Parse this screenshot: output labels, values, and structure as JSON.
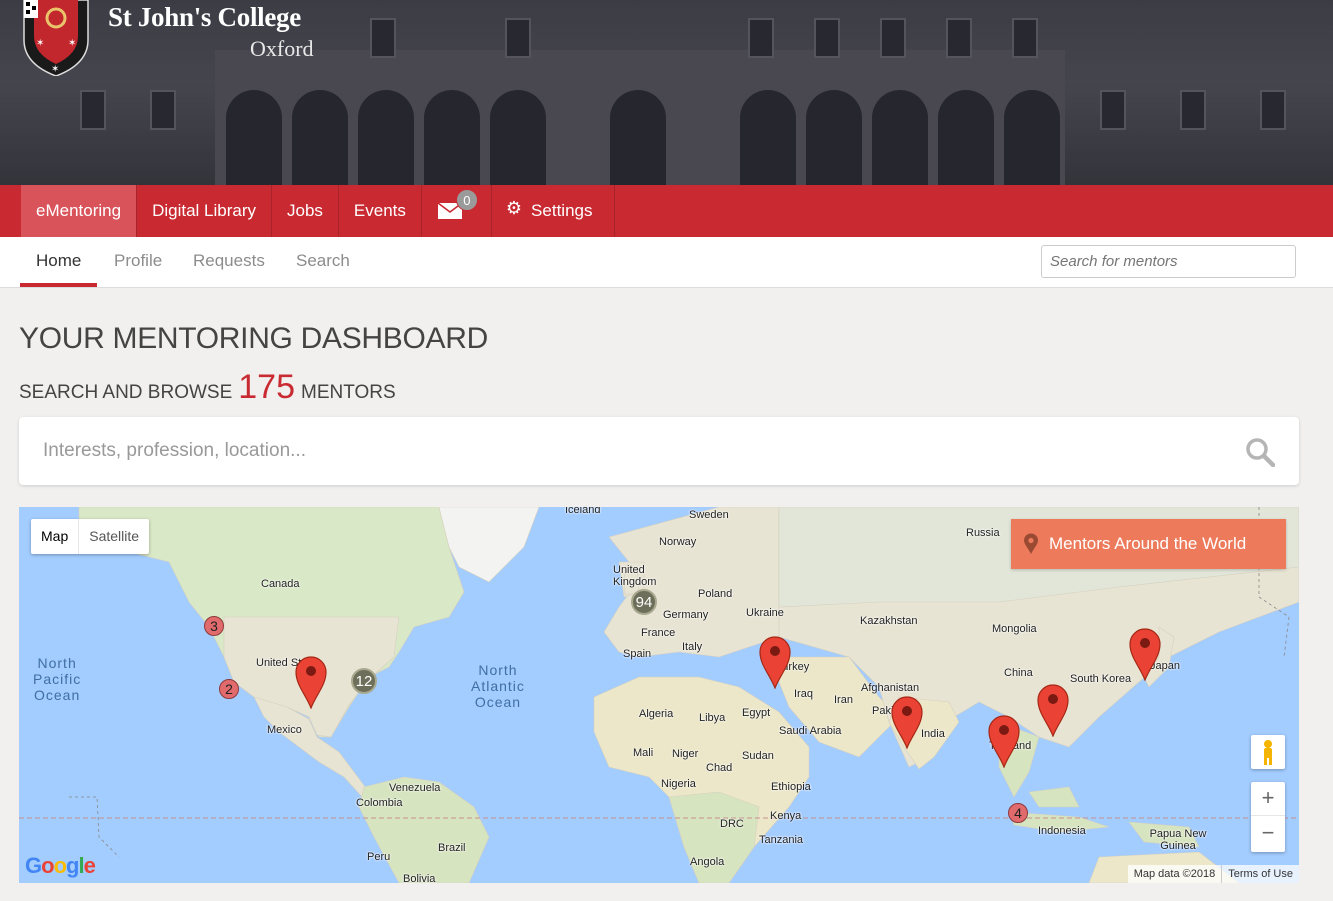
{
  "header": {
    "college_name": "St John's College",
    "college_sub": "Oxford"
  },
  "mainnav": {
    "items": [
      {
        "label": "eMentoring",
        "active": true
      },
      {
        "label": "Digital Library"
      },
      {
        "label": "Jobs"
      },
      {
        "label": "Events"
      }
    ],
    "mail_count": "0",
    "settings_label": "Settings"
  },
  "subnav": {
    "tabs": [
      {
        "label": "Home",
        "active": true
      },
      {
        "label": "Profile"
      },
      {
        "label": "Requests"
      },
      {
        "label": "Search"
      }
    ],
    "search_placeholder": "Search for mentors"
  },
  "main": {
    "title": "YOUR MENTORING DASHBOARD",
    "browse_prefix": "SEARCH AND BROWSE",
    "mentor_count": "175",
    "browse_suffix": "MENTORS",
    "search_placeholder": "Interests, profession, location..."
  },
  "map": {
    "type_map": "Map",
    "type_satellite": "Satellite",
    "overlay_button": "Mentors Around the World",
    "footer_data": "Map data ©2018",
    "footer_terms": "Terms of Use",
    "google": "Google",
    "zoom_in": "+",
    "zoom_out": "−",
    "clusters": [
      {
        "count": "3",
        "color": "red"
      },
      {
        "count": "2",
        "color": "red"
      },
      {
        "count": "12",
        "color": "olive"
      },
      {
        "count": "94",
        "color": "olive"
      },
      {
        "count": "4",
        "color": "red"
      }
    ],
    "labels": {
      "iceland": "Iceland",
      "sweden": "Sweden",
      "norway": "Norway",
      "russia": "Russia",
      "united_kingdom": "United Kingdom",
      "poland": "Poland",
      "germany": "Germany",
      "ukraine": "Ukraine",
      "kazakhstan": "Kazakhstan",
      "mongolia": "Mongolia",
      "france": "France",
      "spain": "Spain",
      "italy": "Italy",
      "turkey": "Turkey",
      "canada": "Canada",
      "united_states": "United States",
      "mexico": "Mexico",
      "china": "China",
      "south_korea": "South Korea",
      "japan": "Japan",
      "afghanistan": "Afghanistan",
      "iran": "Iran",
      "iraq": "Iraq",
      "pakistan": "Pakistan",
      "india": "India",
      "thailand": "Thailand",
      "algeria": "Algeria",
      "libya": "Libya",
      "egypt": "Egypt",
      "saudi_arabia": "Saudi Arabia",
      "mali": "Mali",
      "niger": "Niger",
      "chad": "Chad",
      "sudan": "Sudan",
      "nigeria": "Nigeria",
      "ethiopia": "Ethiopia",
      "kenya": "Kenya",
      "drc": "DRC",
      "tanzania": "Tanzania",
      "angola": "Angola",
      "venezuela": "Venezuela",
      "colombia": "Colombia",
      "peru": "Peru",
      "brazil": "Brazil",
      "bolivia": "Bolivia",
      "indonesia": "Indonesia",
      "papua_new_guinea": "Papua New Guinea",
      "north_pacific": "North\nPacific\nOcean",
      "north_atlantic": "North\nAtlantic\nOcean"
    }
  },
  "colors": {
    "brand_red": "#c92a32",
    "overlay_orange": "#ec7a5b",
    "water": "#a3ccff",
    "land": "#e8e4d4"
  }
}
